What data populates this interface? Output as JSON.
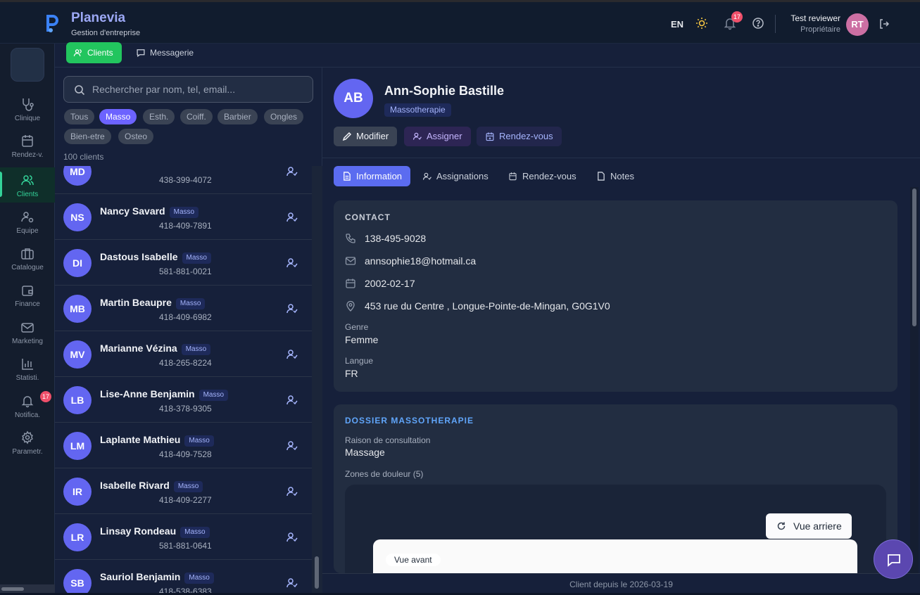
{
  "app": {
    "name": "Planevia",
    "subtitle": "Gestion d'entreprise"
  },
  "topbar": {
    "lang": "EN",
    "notif_count": "17",
    "user_name": "Test reviewer",
    "user_role": "Propriétaire",
    "user_initials": "RT"
  },
  "sidebar": {
    "items": [
      {
        "label": "Clinique",
        "icon": "stethoscope-icon"
      },
      {
        "label": "Rendez-v.",
        "icon": "calendar-icon"
      },
      {
        "label": "Clients",
        "icon": "users-icon",
        "active": true
      },
      {
        "label": "Equipe",
        "icon": "team-settings-icon"
      },
      {
        "label": "Catalogue",
        "icon": "briefcase-icon"
      },
      {
        "label": "Finance",
        "icon": "wallet-icon"
      },
      {
        "label": "Marketing",
        "icon": "mail-icon"
      },
      {
        "label": "Statisti.",
        "icon": "bar-chart-icon"
      },
      {
        "label": "Notifica.",
        "icon": "bell-icon",
        "badge": "17"
      },
      {
        "label": "Parametr.",
        "icon": "gear-icon"
      }
    ]
  },
  "tabs": {
    "clients": "Clients",
    "messagerie": "Messagerie"
  },
  "list": {
    "search_placeholder": "Rechercher par nom, tel, email...",
    "filters": [
      "Tous",
      "Masso",
      "Esth.",
      "Coiff.",
      "Barbier",
      "Ongles",
      "Bien-etre",
      "Osteo"
    ],
    "active_filter": "Masso",
    "count_label": "100 clients",
    "clients": [
      {
        "initials": "MD",
        "name": "",
        "tag": "",
        "phone": "438-399-4072"
      },
      {
        "initials": "NS",
        "name": "Nancy Savard",
        "tag": "Masso",
        "phone": "418-409-7891"
      },
      {
        "initials": "DI",
        "name": "Dastous Isabelle",
        "tag": "Masso",
        "phone": "581-881-0021"
      },
      {
        "initials": "MB",
        "name": "Martin Beaupre",
        "tag": "Masso",
        "phone": "418-409-6982"
      },
      {
        "initials": "MV",
        "name": "Marianne Vézina",
        "tag": "Masso",
        "phone": "418-265-8224"
      },
      {
        "initials": "LB",
        "name": "Lise-Anne Benjamin",
        "tag": "Masso",
        "phone": "418-378-9305"
      },
      {
        "initials": "LM",
        "name": "Laplante Mathieu",
        "tag": "Masso",
        "phone": "418-409-7528"
      },
      {
        "initials": "IR",
        "name": "Isabelle Rivard",
        "tag": "Masso",
        "phone": "418-409-2277"
      },
      {
        "initials": "LR",
        "name": "Linsay Rondeau",
        "tag": "Masso",
        "phone": "581-881-0641"
      },
      {
        "initials": "SB",
        "name": "Sauriol Benjamin",
        "tag": "Masso",
        "phone": "418-538-6383"
      }
    ]
  },
  "detail": {
    "initials": "AB",
    "name": "Ann-Sophie Bastille",
    "tag": "Massotherapie",
    "buttons": {
      "modifier": "Modifier",
      "assigner": "Assigner",
      "rdv": "Rendez-vous"
    },
    "tabs": [
      "Information",
      "Assignations",
      "Rendez-vous",
      "Notes"
    ],
    "contact": {
      "title": "CONTACT",
      "phone": "138-495-9028",
      "email": "annsophie18@hotmail.ca",
      "birthdate": "2002-02-17",
      "address": "453 rue du Centre , Longue-Pointe-de-Mingan, G0G1V0",
      "genre_label": "Genre",
      "genre": "Femme",
      "langue_label": "Langue",
      "langue": "FR"
    },
    "dossier": {
      "title": "DOSSIER MASSOTHERAPIE",
      "raison_label": "Raison de consultation",
      "raison": "Massage",
      "zones_label": "Zones de douleur (5)",
      "vue_arriere": "Vue arriere",
      "vue_avant": "Vue avant"
    },
    "footer": "Client depuis le 2026-03-19"
  },
  "colors": {
    "accent": "#6c63ff",
    "green": "#22c55e",
    "badge": "#ef4f6a"
  }
}
